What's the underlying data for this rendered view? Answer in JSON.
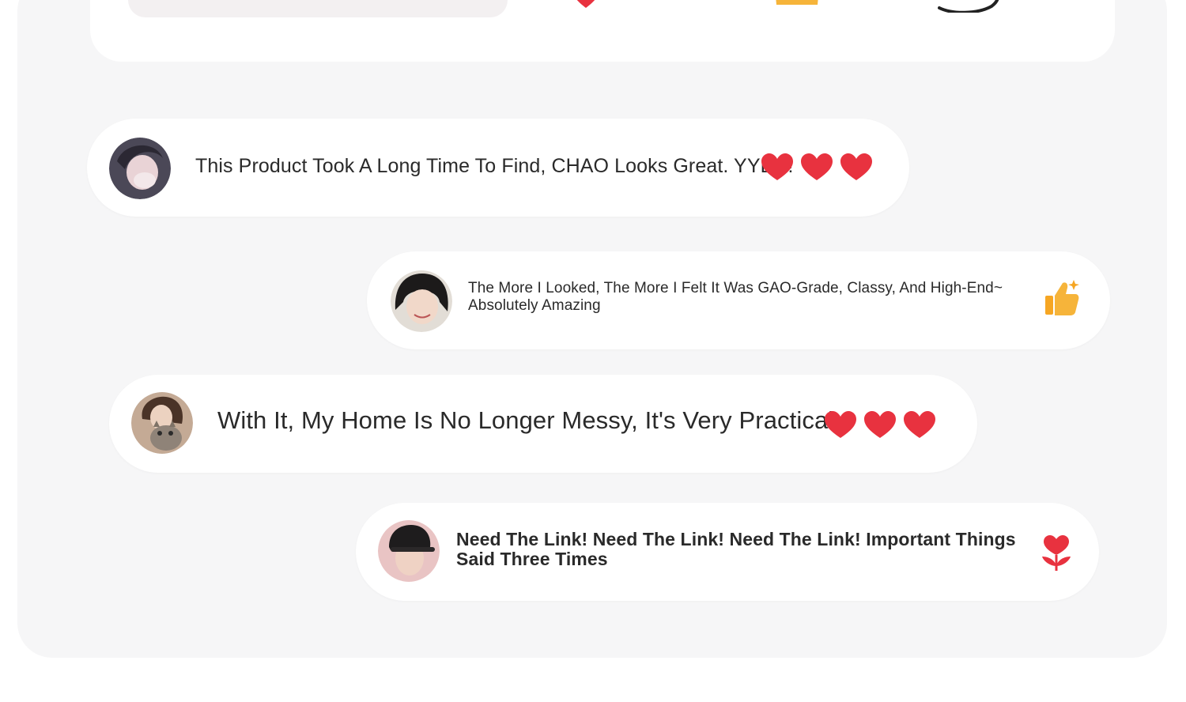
{
  "top_card": {
    "icons": [
      "heart-icon",
      "gift-icon",
      "chat-bubble-icon"
    ]
  },
  "comments": [
    {
      "avatar": "avatar-woman-masked",
      "text": "This Product Took A Long Time To Find, CHAO Looks Great. YYDS!",
      "emoji": [
        "heart-icon",
        "heart-icon",
        "heart-icon"
      ]
    },
    {
      "avatar": "avatar-woman-smiling",
      "text": "The More I Looked, The More I Felt It Was GAO-Grade, Classy, And High-End~ Absolutely Amazing",
      "emoji": [
        "thumbs-up-icon"
      ]
    },
    {
      "avatar": "avatar-woman-with-cat",
      "text": "With It, My Home Is No Longer Messy, It's Very Practical",
      "emoji": [
        "heart-icon",
        "heart-icon",
        "heart-icon"
      ]
    },
    {
      "avatar": "avatar-man-in-cap",
      "text": "Need The Link! Need The Link! Need The Link! Important Things Said Three Times",
      "emoji": [
        "rose-icon"
      ]
    }
  ],
  "colors": {
    "panel": "#f6f6f7",
    "bubble": "#ffffff",
    "heart": "#e8323f",
    "thumb": "#f6a623"
  }
}
